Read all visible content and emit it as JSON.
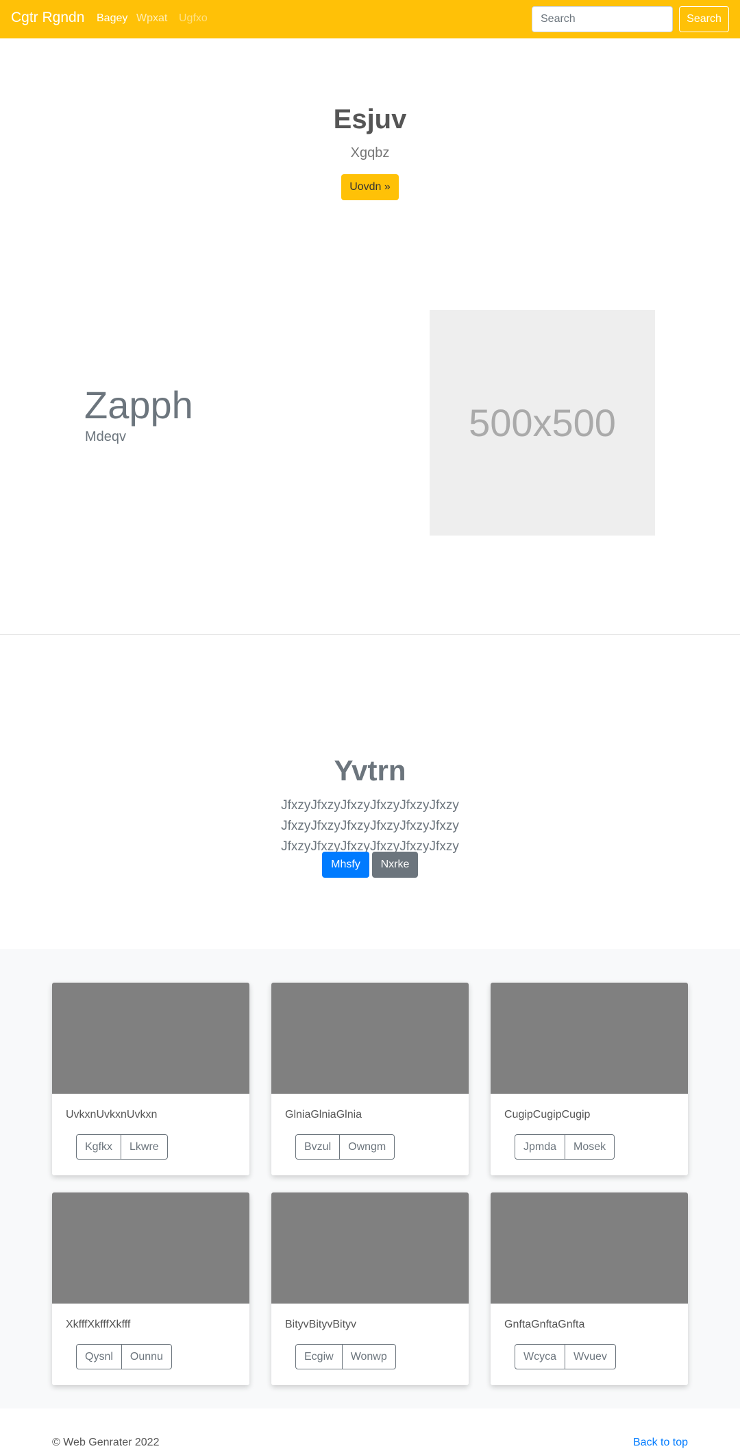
{
  "navbar": {
    "brand": "Cgtr Rgndn",
    "links": [
      "Bagey",
      "Wpxat",
      "Ugfxo"
    ],
    "search_placeholder": "Search",
    "search_button": "Search",
    "color": "#ffc107"
  },
  "hero": {
    "title": "Esjuv",
    "subtitle": "Xgqbz",
    "button": "Uovdn »"
  },
  "feature": {
    "title": "Zapph",
    "subtitle": "Mdeqv",
    "image_text": "500x500"
  },
  "jumbotron": {
    "title": "Yvtrn",
    "lead": "JfxzyJfxzyJfxzyJfxzyJfxzyJfxzy JfxzyJfxzyJfxzyJfxzyJfxzyJfxzy JfxzyJfxzyJfxzyJfxzyJfxzyJfxzy",
    "primary_button": "Mhsfy",
    "secondary_button": "Nxrke",
    "primary_color": "#007bff",
    "secondary_color": "#6c757d"
  },
  "cards": [
    {
      "text": "UvkxnUvkxnUvkxn",
      "buttons": [
        "Kgfkx",
        "Lkwre"
      ]
    },
    {
      "text": "GlniaGlniaGlnia",
      "buttons": [
        "Bvzul",
        "Owngm"
      ]
    },
    {
      "text": "CugipCugipCugip",
      "buttons": [
        "Jpmda",
        "Mosek"
      ]
    },
    {
      "text": "XkfffXkfffXkfff",
      "buttons": [
        "Qysnl",
        "Ounnu"
      ]
    },
    {
      "text": "BityvBityvBityv",
      "buttons": [
        "Ecgiw",
        "Wonwp"
      ]
    },
    {
      "text": "GnftaGnftaGnfta",
      "buttons": [
        "Wcyca",
        "Wvuev"
      ]
    }
  ],
  "footer": {
    "copyright": "© Web Genrater 2022",
    "back_to_top": "Back to top"
  }
}
